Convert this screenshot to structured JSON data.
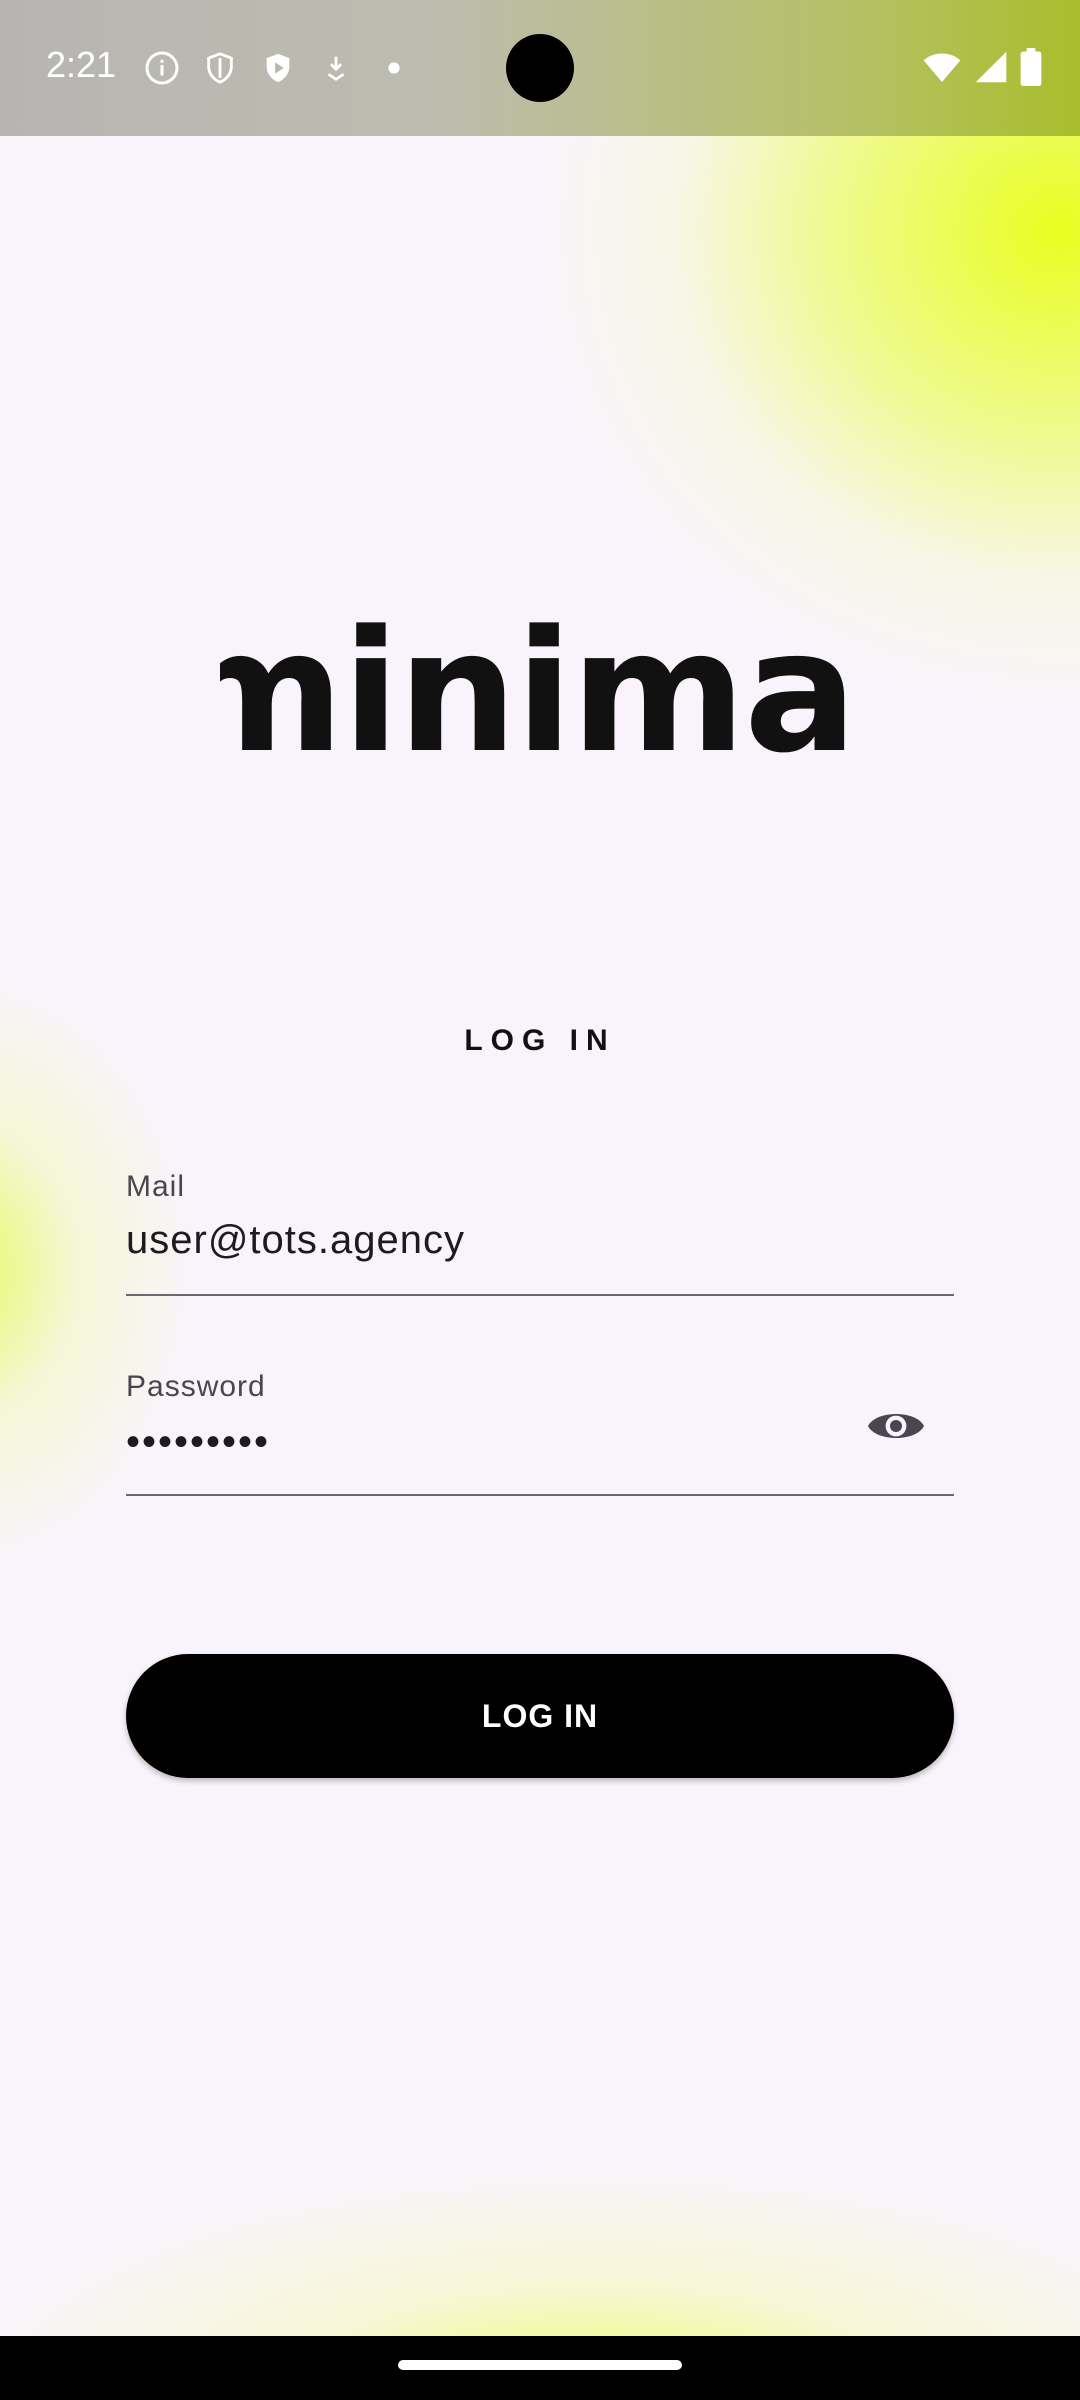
{
  "status_bar": {
    "time": "2:21",
    "left_icons": [
      "info-icon",
      "shield-icon",
      "play-protect-icon",
      "download-icon",
      "dot-icon"
    ],
    "right_icons": [
      "wifi-icon",
      "signal-icon",
      "battery-icon"
    ]
  },
  "logo": {
    "text": "minimal"
  },
  "login": {
    "title": "LOG IN",
    "mail_label": "Mail",
    "mail_value": "user@tots.agency",
    "password_label": "Password",
    "password_value": "•••••••••",
    "toggle_visibility_icon": "eye-icon",
    "submit_label": "LOG IN"
  },
  "colors": {
    "accent": "#E6FF14",
    "button_bg": "#000000",
    "button_text": "#FFFFFF",
    "background": "#F9F4FB"
  }
}
